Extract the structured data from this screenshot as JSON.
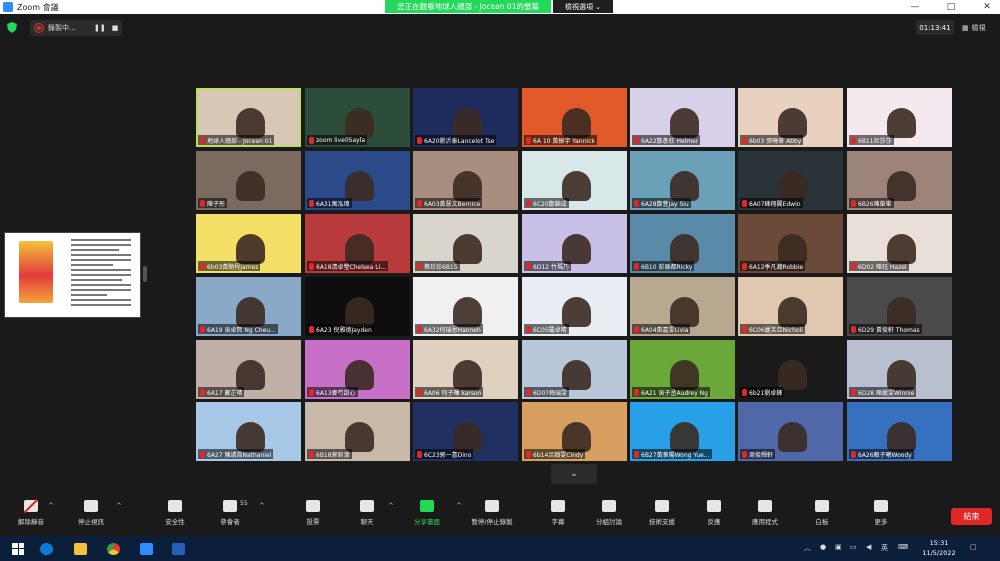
{
  "window": {
    "title": "Zoom 會議",
    "share_banner": "您正在觀看地球人總部 - Jocean 01的螢幕",
    "view_options": "檢視選項 ⌄"
  },
  "topbar": {
    "recording_label": "錄製中...",
    "timer": "01:13:41",
    "view_label": "檢視"
  },
  "gallery": {
    "tiles": [
      "地球人總部 - Jocean 01",
      "zoom live05ayla",
      "6A20劉沂泰Lancelot Tse",
      "6A 10 黃振宇 Yannick",
      "6A22鄭彥欣 Helmer",
      "6b03 張曉章 Abby",
      "6B11尼莎莎",
      "陳子彤",
      "6A31寓泓璋",
      "6A03黃慧文Bernice",
      "6C20鄭錦成",
      "6A28鄭萱Jay Siu",
      "6A07峰翔翼Edwin",
      "6B26陳榮峯",
      "6b03黃馳程James",
      "6A18清卓瑩Chelsea Li...",
      "蔡珍珍6B15",
      "6D12 竹瑪乃",
      "6B10 彭展都Ricky",
      "6A12季凡瀚Robbie",
      "6D02 陳珏 Hazel",
      "6A19 吳卓熙 Ng Cheu...",
      "6A23 倪雅德Jayden",
      "6A32何瑞恩Hanneh",
      "6C05羅卓晴",
      "6A04黃嘉雯Livia",
      "6C06麗芙亞Nicholi",
      "6D29 黃俊軒 Thomas",
      "6A17 鄺芷晴",
      "6A13麥芍甜心",
      "6A06 何子暉 karson",
      "6D07梅瑞雯",
      "6A21 吳子丞Audrey Ng",
      "6b21劉卓鋒",
      "6D28 陳麗雯Winnie",
      "6A27 陳靖昌Nathaniel",
      "6B18郭釗濛",
      "6C23郭一喜Dino",
      "6b14呂翰雯Cindy",
      "6B27黃華陽Wong Yue...",
      "周俊輝軒",
      "6A26賴子曦Woody"
    ],
    "next_page": "⌄"
  },
  "toolbar": {
    "items": [
      {
        "label": "解除靜音"
      },
      {
        "label": "停止視訊"
      },
      {
        "label": "安全性"
      },
      {
        "label": "參會者",
        "count": "55"
      },
      {
        "label": "投票"
      },
      {
        "label": "聊天"
      },
      {
        "label": "分享畫面"
      },
      {
        "label": "暫停/停止錄製"
      },
      {
        "label": "字幕"
      },
      {
        "label": "分組討論"
      },
      {
        "label": "技術支援"
      },
      {
        "label": "反應"
      },
      {
        "label": "應用程式"
      },
      {
        "label": "白板"
      },
      {
        "label": "更多"
      }
    ],
    "end_label": "結束"
  },
  "taskbar": {
    "time": "15:31",
    "date": "11/5/2022",
    "lang": "英"
  }
}
